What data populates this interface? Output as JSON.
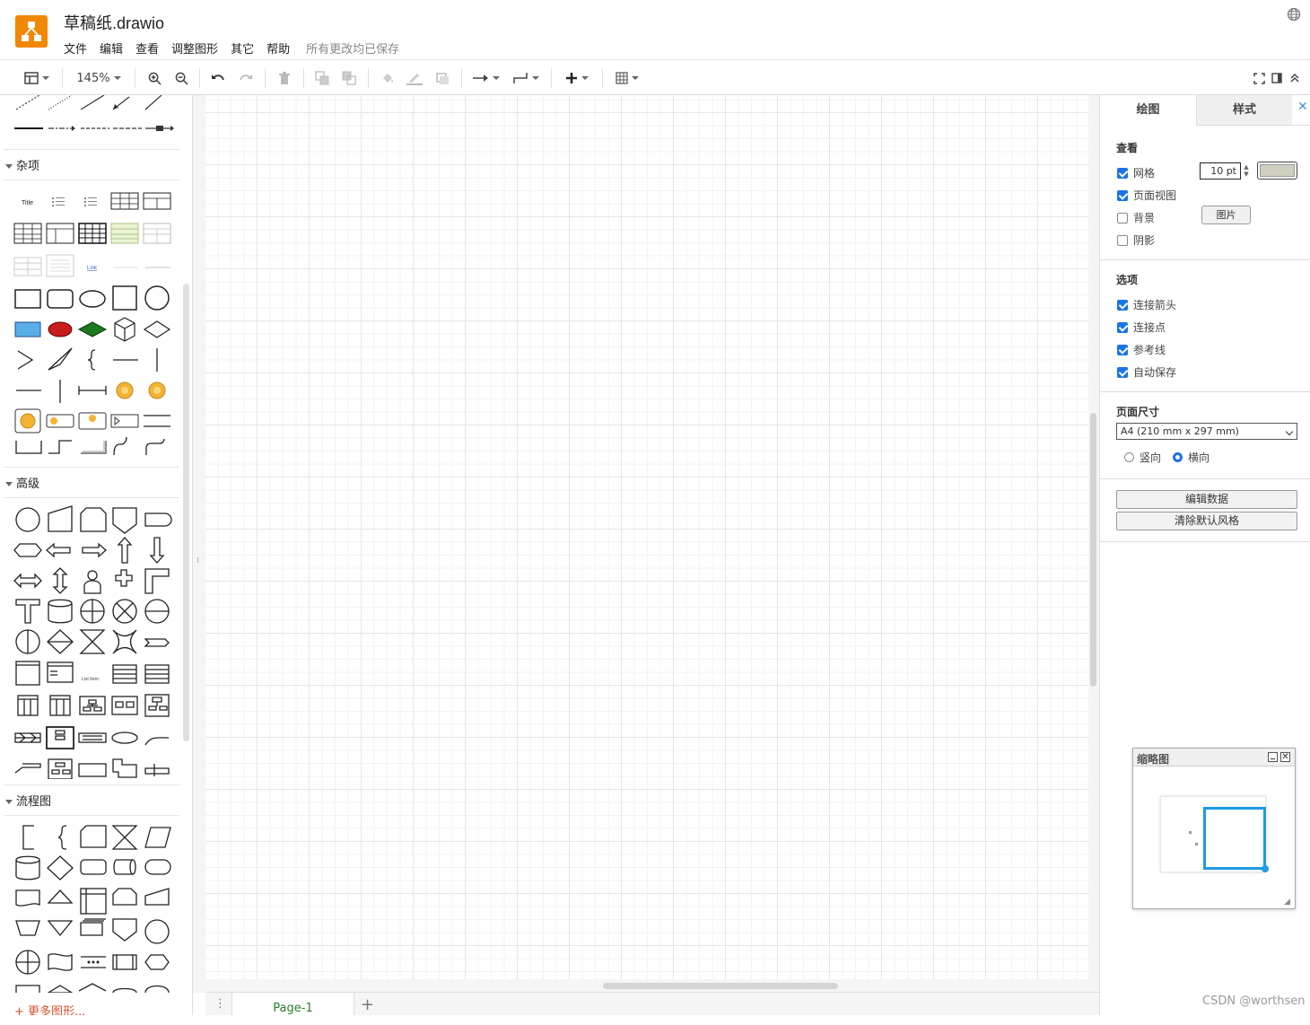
{
  "app": {
    "title": "草稿纸.drawio",
    "save_status": "所有更改均已保存"
  },
  "menu": [
    "文件",
    "编辑",
    "查看",
    "调整图形",
    "其它",
    "帮助"
  ],
  "toolbar": {
    "zoom": "145%"
  },
  "sidebar": {
    "sections": {
      "misc": "杂项",
      "advanced": "高级",
      "flowchart": "流程图"
    },
    "more_shapes": "+ 更多图形...",
    "misc_labels": {
      "title": "Title",
      "link": "Link",
      "list_item": "List Item"
    }
  },
  "page_tabs": {
    "current": "Page-1",
    "menu_icon": "⋮",
    "add": "+"
  },
  "panel": {
    "tabs": {
      "diagram": "绘图",
      "style": "样式"
    },
    "view": {
      "title": "查看",
      "grid": "网格",
      "grid_checked": true,
      "grid_size": "10 pt",
      "page_view": "页面视图",
      "page_view_checked": true,
      "background": "背景",
      "background_checked": false,
      "image_button": "图片",
      "shadow": "阴影",
      "shadow_checked": false
    },
    "options": {
      "title": "选项",
      "items": [
        {
          "label": "连接箭头",
          "checked": true
        },
        {
          "label": "连接点",
          "checked": true
        },
        {
          "label": "参考线",
          "checked": true
        },
        {
          "label": "自动保存",
          "checked": true
        }
      ]
    },
    "page_size": {
      "title": "页面尺寸",
      "selected": "A4 (210 mm x 297 mm)",
      "portrait": "竖向",
      "landscape": "横向",
      "orientation": "landscape"
    },
    "buttons": {
      "edit_data": "编辑数据",
      "clear_style": "清除默认风格"
    }
  },
  "outline": {
    "title": "缩略图"
  },
  "watermark": "CSDN @worthsen",
  "colors": {
    "accent": "#1a73e8",
    "logo": "#f08705",
    "page_tab_text": "#2a7d2a",
    "more_shapes": "#d9512c"
  }
}
